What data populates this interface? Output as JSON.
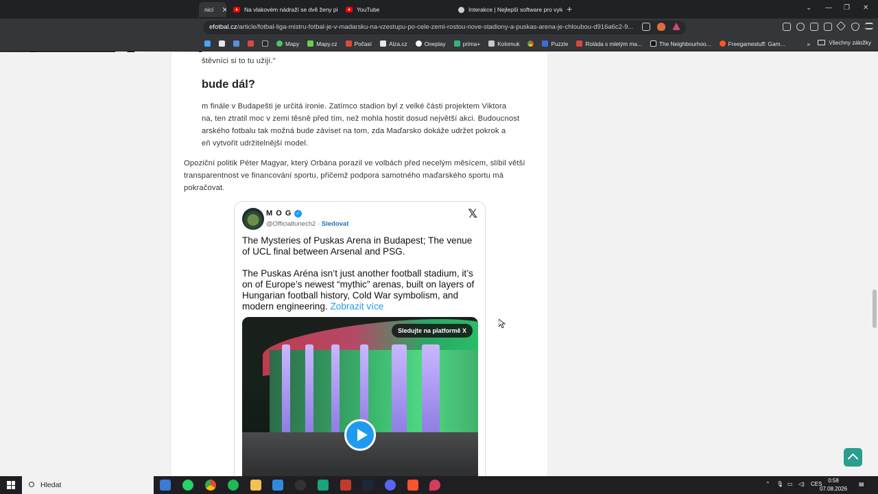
{
  "browser": {
    "tabs": [
      {
        "label": "nicí",
        "active": true
      },
      {
        "label": "Na vlakovém nádraží se dvě ženy při",
        "active": false
      },
      {
        "label": "YouTube",
        "active": false
      },
      {
        "label": "Interakce | Nejlepší software pro vyle",
        "active": false
      }
    ],
    "close_glyph": "✕",
    "new_tab": "+",
    "url_domain": "efotbal.cz",
    "url_path": "/article/fotbal-liga-mistru-fotbal-je-v-madarsku-na-vzestupu-po-cele-zemi-rostou-nove-stadiony-a-puskas-arena-je-chloubou-d916a6c2-9...",
    "bookmarks": [
      "Mapy",
      "Mapy.cz",
      "Počasí",
      "Alza.cz",
      "Oneplay",
      "prima+",
      "Kolomuk",
      "Puzzle",
      "Roláda s mletým ma...",
      "The Neighbourhoo...",
      "Freegamestuff: Gam..."
    ],
    "all_bookmarks": "Všechny záložky",
    "more_bookmarks": "»"
  },
  "article": {
    "quote_tail": "štěvníci si to tu užijí.\"",
    "heading": "bude dál?",
    "para1": [
      "m finále v Budapešti je určitá ironie. Zatímco stadion byl z velké části projektem Viktora",
      "na, ten ztratil moc v zemi těsně před tím, než mohla hostit dosud největší akci. Budoucnost",
      "arského fotbalu tak možná bude záviset na tom, zda Maďarsko dokáže udržet pokrok a",
      "eň vytvořit udržitelnější model."
    ],
    "para2": [
      "Opoziční politik Péter Magyar, který Orbána porazil ve volbách před necelým měsícem, slíbil větší",
      "transparentnost ve financování sportu, přičemž podpora samotného maďarského sportu má",
      "pokračovat."
    ]
  },
  "tweet": {
    "name": "M O G",
    "verified_glyph": "✓",
    "handle": "@Officialtunech2 · ",
    "follow": "Sledovat",
    "x_logo": "𝕏",
    "line1": "The Mysteries of Puskas Arena in Budapest; The venue of UCL final between Arsenal and PSG.",
    "line2": "The Puskas Aréna isn’t just another football stadium, it’s on of Europe’s newest “mythic” arenas, built on layers of Hungarian football history, Cold War symbolism, and modern engineering.",
    "more": "Zobrazit více",
    "watch_on_x": "Sledujte na platformě X"
  },
  "taskbar": {
    "search_placeholder": "Hledat",
    "language": "CES",
    "time": "0:58",
    "date": "07.08.2026"
  },
  "colors": {
    "accent_link": "#1d6fb8",
    "tweet_link": "#1d9bf0",
    "scroll_top_button": "#2a9d8f"
  }
}
